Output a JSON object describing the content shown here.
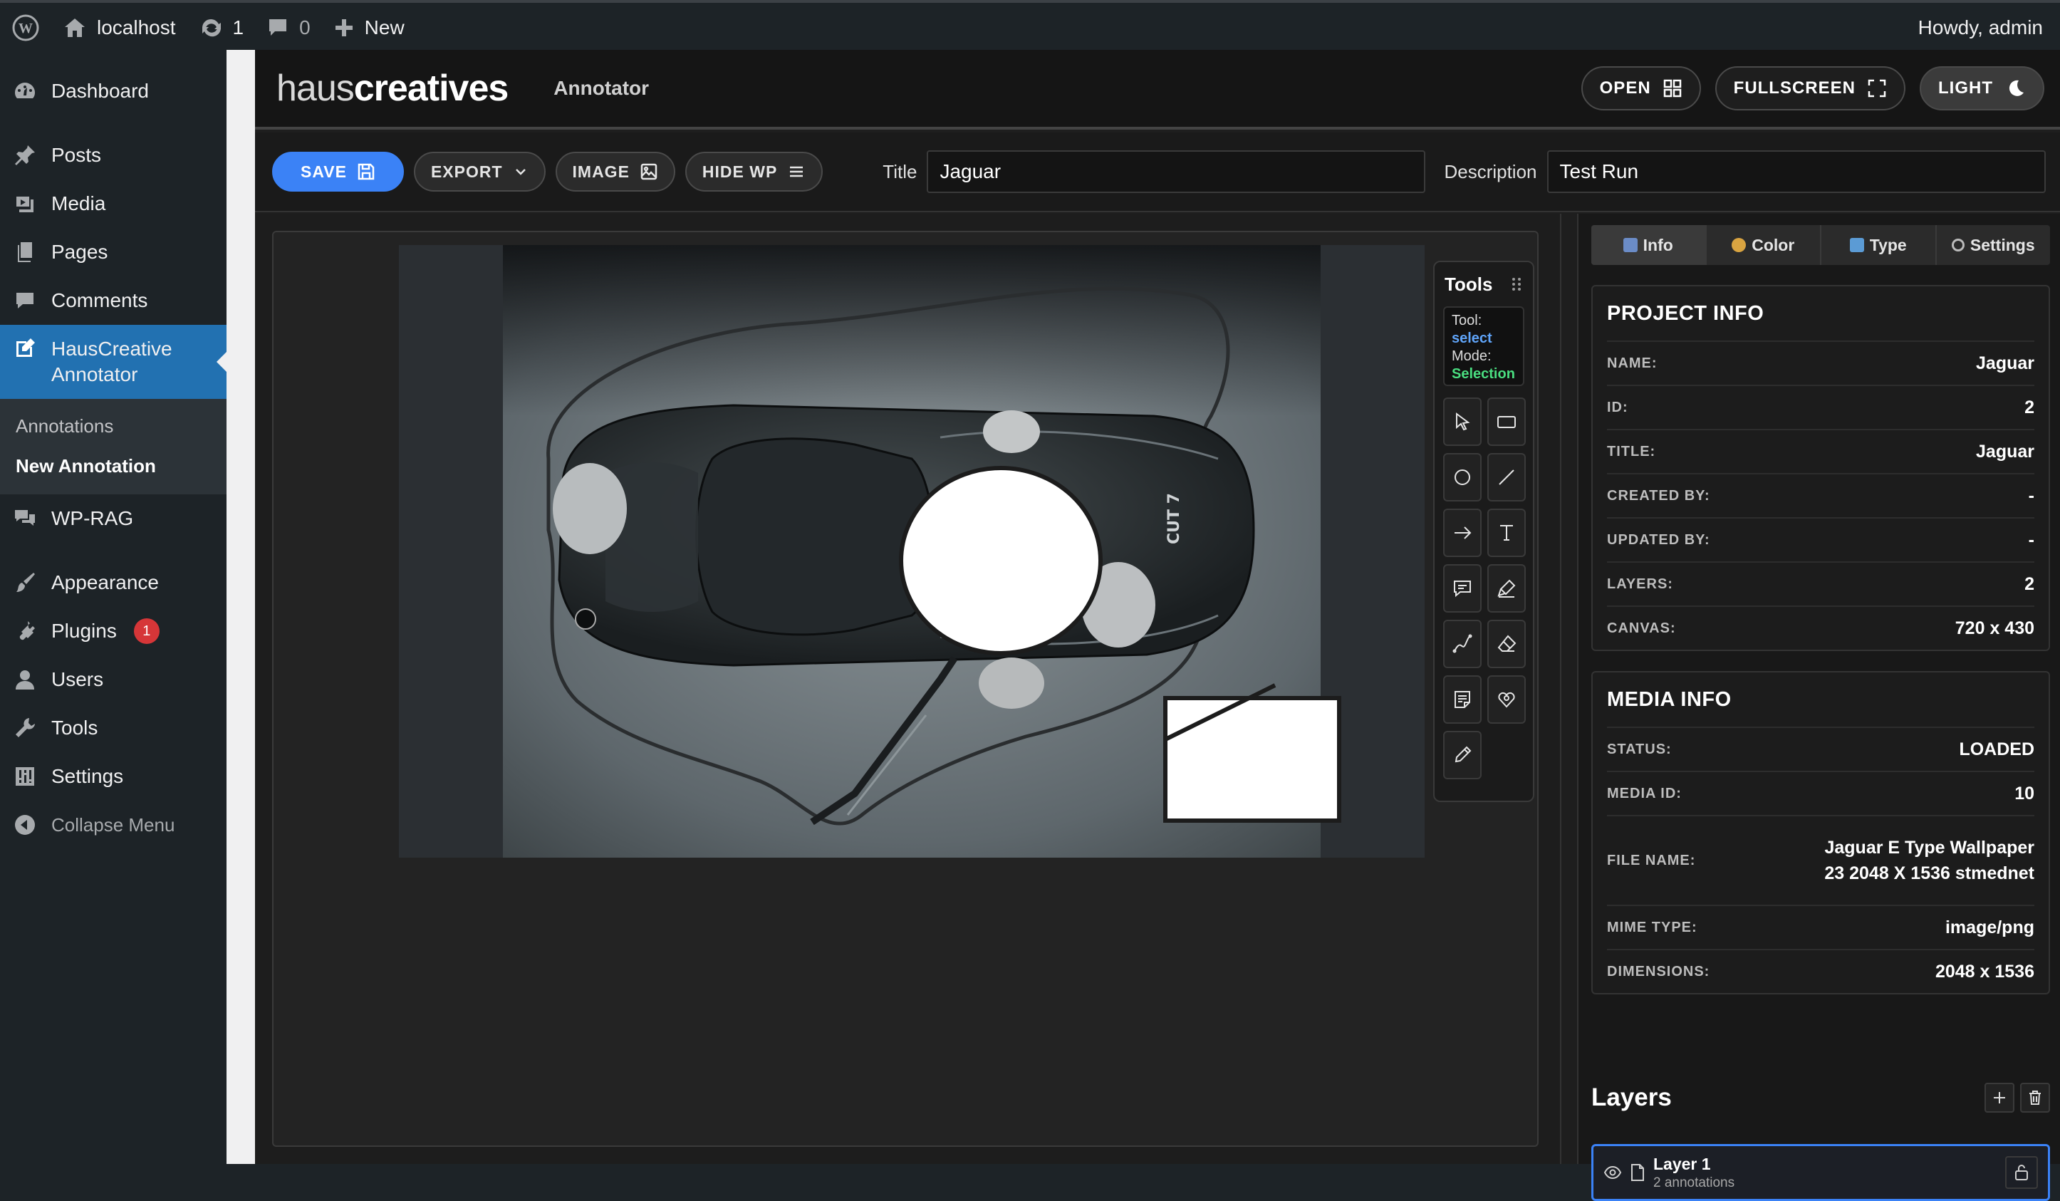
{
  "adminbar": {
    "site": "localhost",
    "updates_count": "1",
    "comments_count": "0",
    "new_label": "New",
    "greeting": "Howdy, admin"
  },
  "menu": {
    "dashboard": "Dashboard",
    "posts": "Posts",
    "media": "Media",
    "pages": "Pages",
    "comments": "Comments",
    "annotator": "HausCreative Annotator",
    "sub_annotations": "Annotations",
    "sub_new": "New Annotation",
    "wprag": "WP-RAG",
    "appearance": "Appearance",
    "plugins": "Plugins",
    "plugins_badge": "1",
    "users": "Users",
    "tools": "Tools",
    "settings": "Settings",
    "collapse": "Collapse Menu"
  },
  "header": {
    "logo_thin": "haus",
    "logo_bold": "creatives",
    "subtitle": "Annotator",
    "open_label": "OPEN",
    "fullscreen_label": "FULLSCREEN",
    "light_label": "LIGHT"
  },
  "toolbar": {
    "save_label": "SAVE",
    "export_label": "EXPORT",
    "image_label": "IMAGE",
    "hidewp_label": "HIDE WP",
    "title_label": "Title",
    "title_value": "Jaguar",
    "description_label": "Description",
    "description_value": "Test Run"
  },
  "tools": {
    "heading": "Tools",
    "tool_label": "Tool:",
    "tool_value": "select",
    "mode_label": "Mode:",
    "mode_value": "Selection",
    "icons": [
      "pointer-icon",
      "rectangle-icon",
      "circle-icon",
      "line-icon",
      "arrow-icon",
      "text-icon",
      "speech-bubble-icon",
      "highlighter-icon",
      "freehand-icon",
      "eraser-icon",
      "note-icon",
      "heart-icon",
      "pen-icon"
    ]
  },
  "image": {
    "watermark": "",
    "car_mark": "CUT 7"
  },
  "panel": {
    "tabs": [
      "Info",
      "Color",
      "Type",
      "Settings"
    ],
    "project": {
      "title": "PROJECT INFO",
      "name_k": "NAME:",
      "name_v": "Jaguar",
      "id_k": "ID:",
      "id_v": "2",
      "title_k": "TITLE:",
      "title_v": "Jaguar",
      "created_k": "CREATED BY:",
      "created_v": "-",
      "updated_k": "UPDATED BY:",
      "updated_v": "-",
      "layers_k": "LAYERS:",
      "layers_v": "2",
      "canvas_k": "CANVAS:",
      "canvas_v": "720 x 430"
    },
    "media": {
      "title": "MEDIA INFO",
      "status_k": "STATUS:",
      "status_v": "LOADED",
      "mediaid_k": "MEDIA ID:",
      "mediaid_v": "10",
      "filename_k": "FILE NAME:",
      "filename_v": "Jaguar E Type Wallpaper 23 2048 X 1536 stmednet",
      "mime_k": "MIME TYPE:",
      "mime_v": "image/png",
      "dims_k": "DIMENSIONS:",
      "dims_v": "2048 x 1536"
    },
    "layers": {
      "heading": "Layers",
      "items": [
        {
          "name": "Layer 1",
          "count": "2 annotations"
        }
      ]
    }
  },
  "colors": {
    "wp_blue": "#2271b1",
    "accent_blue": "#3b82f6",
    "tool_value": "#60a5fa",
    "mode_value": "#4ade80",
    "badge_red": "#d63638"
  }
}
